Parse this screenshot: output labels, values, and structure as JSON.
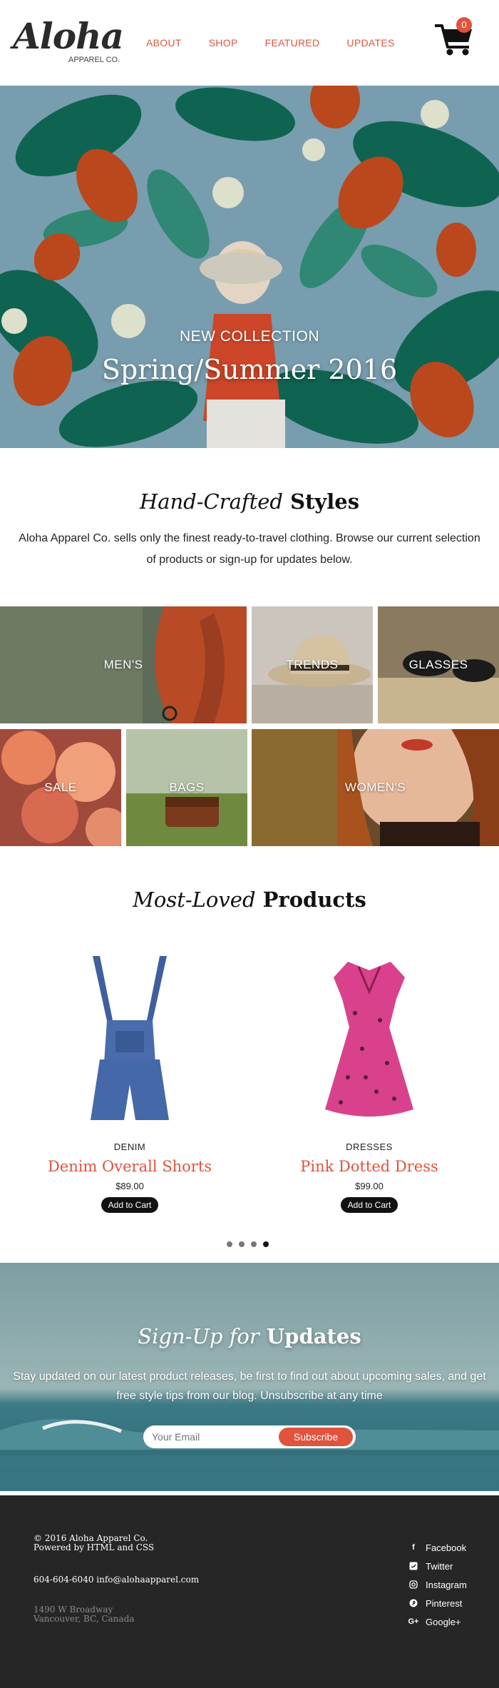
{
  "header": {
    "logo_text": "Aloha",
    "logo_sub": "APPAREL CO.",
    "nav": [
      "ABOUT",
      "SHOP",
      "FEATURED",
      "UPDATES"
    ],
    "cart_count": "0"
  },
  "hero": {
    "kicker": "NEW COLLECTION",
    "title": "Spring/Summer 2016"
  },
  "intro": {
    "title_italic": "Hand-Crafted",
    "title_bold": "Styles",
    "text": "Aloha Apparel Co. sells only the finest ready-to-travel clothing. Browse our current selection of products or sign-up for updates below."
  },
  "categories": [
    "MEN'S",
    "TRENDS",
    "GLASSES",
    "SALE",
    "BAGS",
    "WOMEN'S"
  ],
  "products": {
    "title_italic": "Most-Loved",
    "title_bold": "Products",
    "items": [
      {
        "category": "DENIM",
        "name": "Denim Overall Shorts",
        "price": "$89.00",
        "button": "Add to Cart"
      },
      {
        "category": "DRESSES",
        "name": "Pink Dotted Dress",
        "price": "$99.00",
        "button": "Add to Cart"
      }
    ],
    "carousel_active_index": 4
  },
  "signup": {
    "title_italic": "Sign-Up for",
    "title_bold": "Updates",
    "text": "Stay updated on our latest product releases, be first to find out about upcoming sales, and get free style tips from our blog. Unsubscribe at any time",
    "placeholder": "Your Email",
    "button": "Subscribe"
  },
  "footer": {
    "copyright": "© 2016 Aloha Apparel Co.",
    "powered": "Powered by HTML and CSS",
    "contact": "604-604-6040 info@alohaapparel.com",
    "address_1": "1490 W Broadway",
    "address_2": "Vancouver, BC, Canada",
    "social": [
      "Facebook",
      "Twitter",
      "Instagram",
      "Pinterest",
      "Google+"
    ]
  },
  "colors": {
    "accent": "#e0533d",
    "footer_bg": "#262626",
    "text": "#222222"
  }
}
